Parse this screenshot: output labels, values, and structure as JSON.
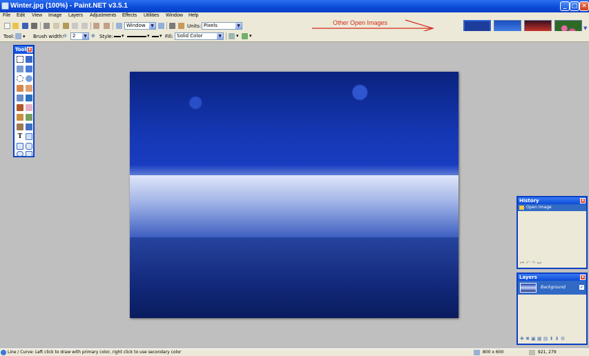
{
  "window": {
    "title": "Winter.jpg (100%) - Paint.NET v3.5.1",
    "buttons": {
      "minimize": "_",
      "maximize": "□",
      "close": "✕"
    }
  },
  "menu": [
    "File",
    "Edit",
    "View",
    "Image",
    "Layers",
    "Adjustments",
    "Effects",
    "Utilities",
    "Window",
    "Help"
  ],
  "toolbar": {
    "zoom_value": "Window",
    "units_label": "Units:",
    "units_value": "Pixels",
    "annotation": "Other Open Images"
  },
  "tool_options": {
    "tool_label": "Tool:",
    "brush_width_label": "Brush width:",
    "brush_width_value": "2",
    "style_label": "Style:",
    "fill_label": "Fill:",
    "fill_value": "Solid Color"
  },
  "tools_window": {
    "title": "Tools",
    "close": "x"
  },
  "history": {
    "title": "History",
    "close": "x",
    "items": [
      "Open Image"
    ]
  },
  "layers": {
    "title": "Layers",
    "close": "x",
    "items": [
      {
        "name": "Background",
        "visible": true
      }
    ]
  },
  "status": {
    "hint": "Line / Curve: Left click to draw with primary color, right click to use secondary color",
    "image_size": "800 x 600",
    "cursor_pos": "921, 279"
  },
  "colors": {
    "accent": "#0b4ad8",
    "panel_bg": "#ece9d8",
    "workspace": "#bfbfbf",
    "annotation": "#d42a1a"
  }
}
